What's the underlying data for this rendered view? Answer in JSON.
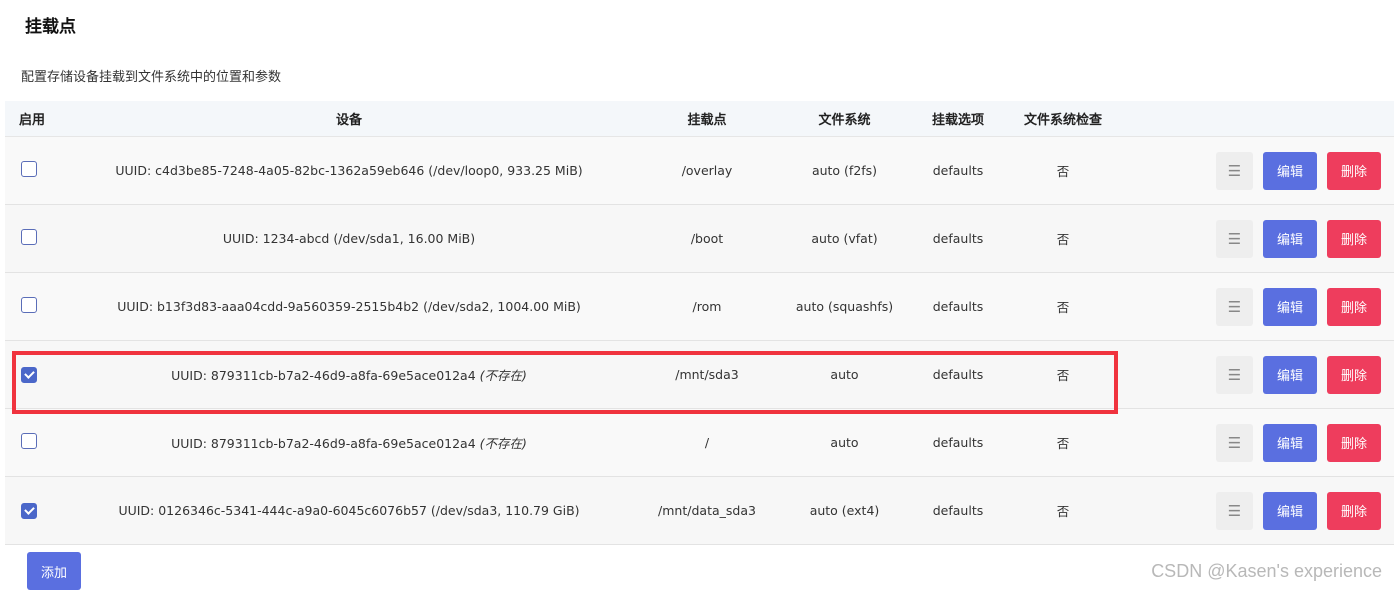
{
  "page": {
    "title": "挂载点",
    "description": "配置存储设备挂载到文件系统中的位置和参数"
  },
  "table": {
    "headers": {
      "enable": "启用",
      "device": "设备",
      "mountpoint": "挂载点",
      "filesystem": "文件系统",
      "options": "挂载选项",
      "fsck": "文件系统检查"
    },
    "rows": [
      {
        "enabled": false,
        "device": "UUID: c4d3be85-7248-4a05-82bc-1362a59eb646 (/dev/loop0, 933.25 MiB)",
        "device_note": "",
        "mountpoint": "/overlay",
        "filesystem": "auto (f2fs)",
        "options": "defaults",
        "fsck": "否"
      },
      {
        "enabled": false,
        "device": "UUID: 1234-abcd (/dev/sda1, 16.00 MiB)",
        "device_note": "",
        "mountpoint": "/boot",
        "filesystem": "auto (vfat)",
        "options": "defaults",
        "fsck": "否"
      },
      {
        "enabled": false,
        "device": "UUID: b13f3d83-aaa04cdd-9a560359-2515b4b2 (/dev/sda2, 1004.00 MiB)",
        "device_note": "",
        "mountpoint": "/rom",
        "filesystem": "auto (squashfs)",
        "options": "defaults",
        "fsck": "否"
      },
      {
        "enabled": true,
        "device": "UUID: 879311cb-b7a2-46d9-a8fa-69e5ace012a4 ",
        "device_note": "(不存在)",
        "mountpoint": "/mnt/sda3",
        "filesystem": "auto",
        "options": "defaults",
        "fsck": "否"
      },
      {
        "enabled": false,
        "device": "UUID: 879311cb-b7a2-46d9-a8fa-69e5ace012a4 ",
        "device_note": "(不存在)",
        "mountpoint": "/",
        "filesystem": "auto",
        "options": "defaults",
        "fsck": "否"
      },
      {
        "enabled": true,
        "device": "UUID: 0126346c-5341-444c-a9a0-6045c6076b57 (/dev/sda3, 110.79 GiB)",
        "device_note": "",
        "mountpoint": "/mnt/data_sda3",
        "filesystem": "auto (ext4)",
        "options": "defaults",
        "fsck": "否"
      }
    ],
    "actions": {
      "handle_icon": "☰",
      "edit_label": "编辑",
      "delete_label": "删除"
    }
  },
  "footer": {
    "add_label": "添加"
  },
  "watermark": "CSDN @Kasen's experience",
  "colors": {
    "primary": "#5a6fe0",
    "danger": "#ee3d5d",
    "highlight": "#f0333e"
  }
}
